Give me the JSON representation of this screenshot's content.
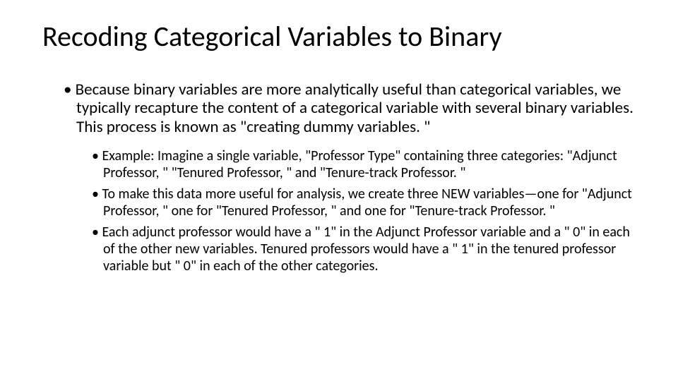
{
  "slide": {
    "title": "Recoding Categorical Variables to Binary",
    "bullet1": "Because binary variables are more analytically useful than categorical variables, we typically recapture the content of a categorical variable with several binary variables. This process is known as \"creating dummy variables. \"",
    "sub1": "Example: Imagine a single variable, \"Professor Type\" containing three categories: \"Adjunct Professor, \" \"Tenured Professor, \" and \"Tenure-track Professor. \"",
    "sub2": "To make this data more useful for analysis, we create three NEW variables—one for \"Adjunct Professor, \" one for \"Tenured Professor, \" and one for \"Tenure-track Professor. \"",
    "sub3": "Each adjunct professor would have a \" 1\" in the Adjunct Professor variable and a \" 0\" in each of the other new variables. Tenured professors would have a \" 1\" in the tenured professor variable but \" 0\" in each of the other categories."
  }
}
